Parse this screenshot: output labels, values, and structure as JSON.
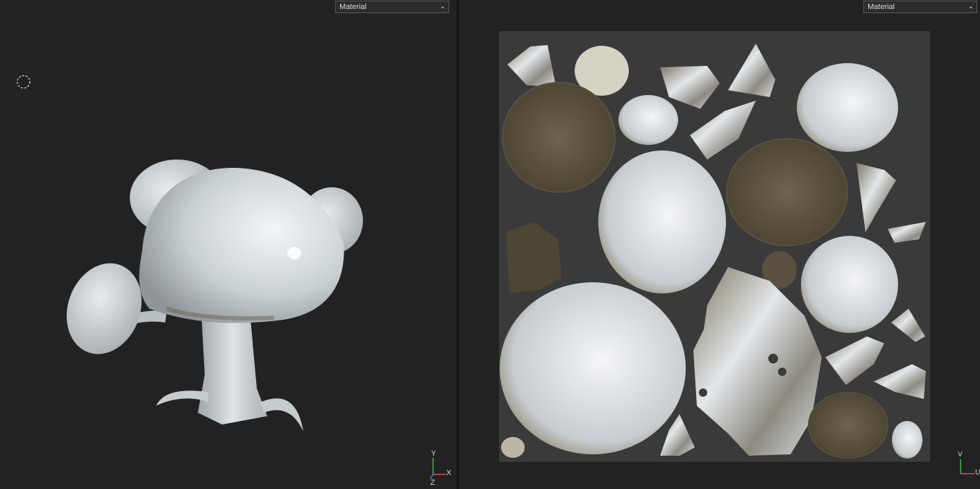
{
  "viewport_3d": {
    "shading_mode": "Material",
    "axis_labels": {
      "y": "Y",
      "x": "X",
      "z": "Z"
    }
  },
  "viewport_uv": {
    "shading_mode": "Material",
    "axis_labels": {
      "v": "V",
      "u": "U"
    }
  },
  "colors": {
    "background": "#222222",
    "uv_sheet": "#3a3a3a",
    "mesh_light": "#d9dee2",
    "mesh_dark": "#5a4f3a"
  }
}
